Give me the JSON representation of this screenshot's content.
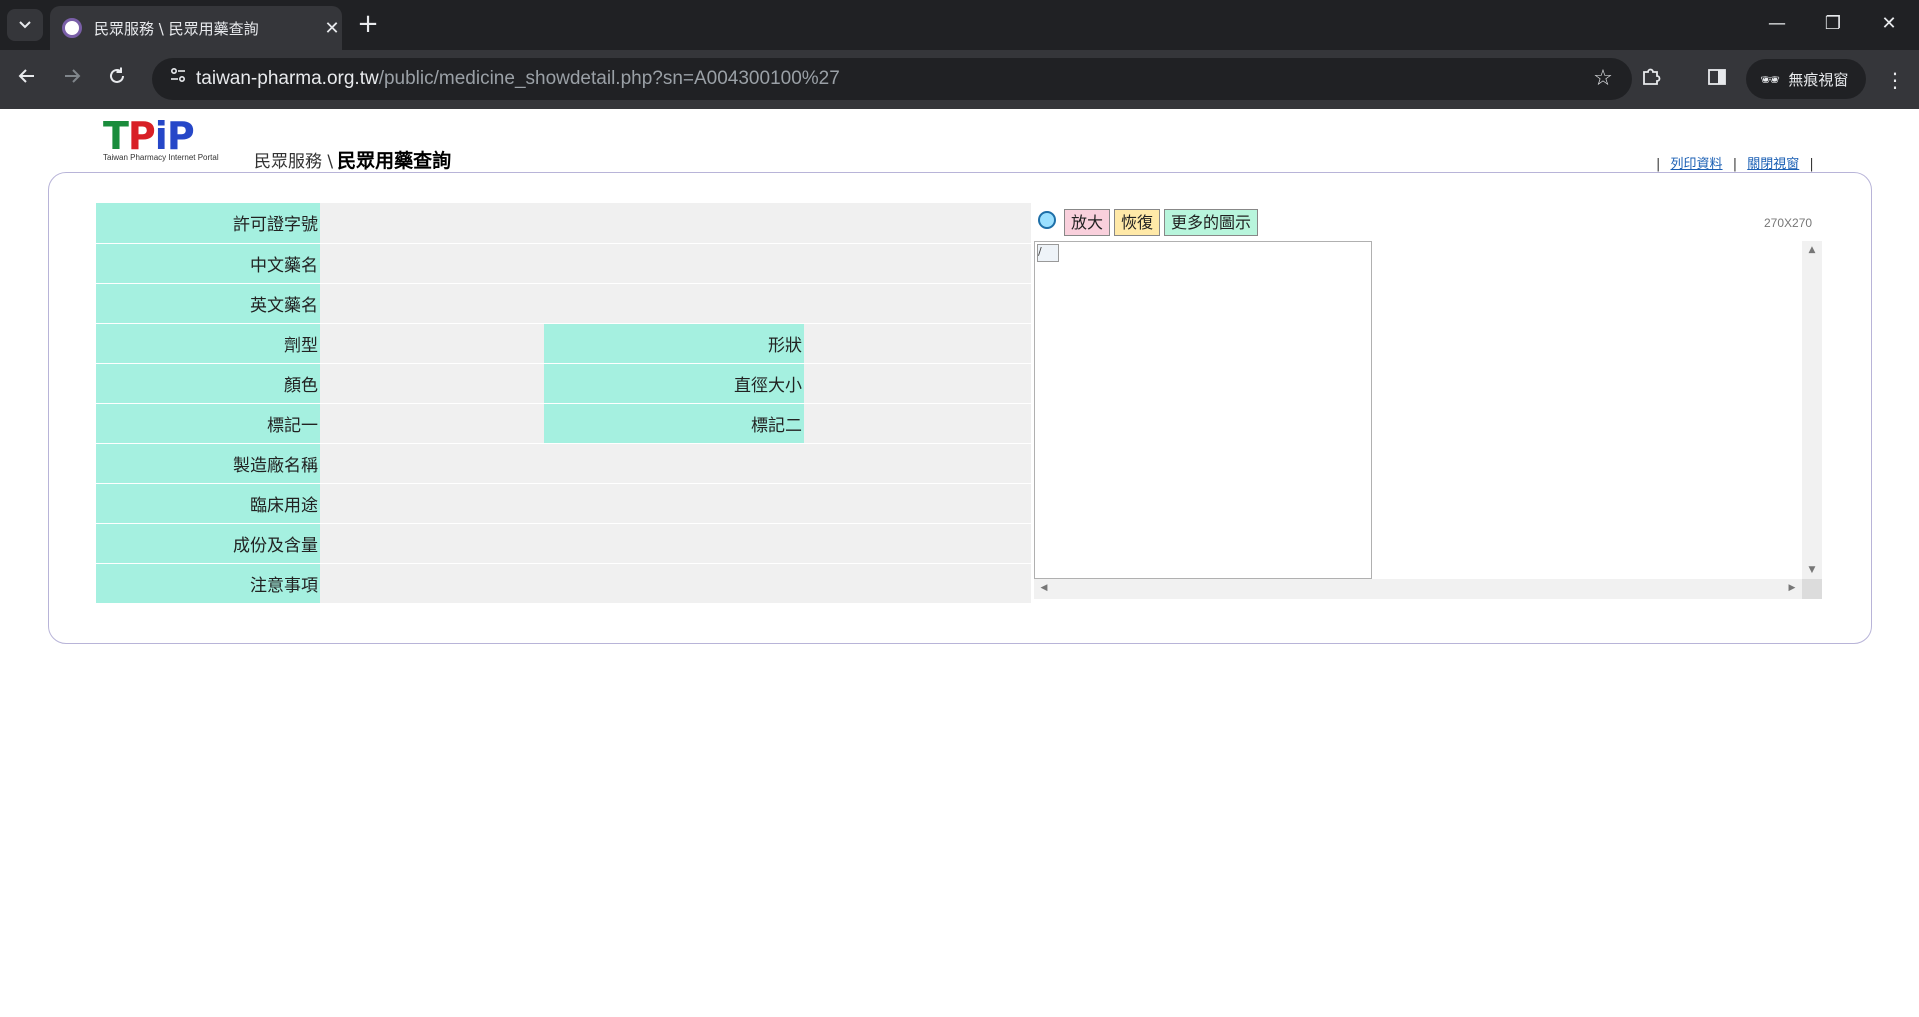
{
  "browser": {
    "tab_title": "民眾服務 \\ 民眾用藥查詢",
    "url_host": "taiwan-pharma.org.tw",
    "url_path": "/public/medicine_showdetail.php?sn=A004300100%27",
    "incognito_label": "無痕視窗",
    "icons": {
      "tab_search": "chevron-down-icon",
      "tab_close": "close-icon",
      "new_tab": "plus-icon",
      "back": "arrow-left-icon",
      "forward": "arrow-right-icon",
      "reload": "reload-icon",
      "site_info": "site-info-icon",
      "bookmark": "star-icon",
      "extensions": "puzzle-icon",
      "side_panel": "side-panel-icon",
      "incognito": "incognito-icon",
      "menu": "more-vert-icon",
      "minimize": "minimize-icon",
      "restore": "restore-icon",
      "close_window": "close-icon"
    }
  },
  "logo": {
    "letters": [
      "T",
      "P",
      "i",
      "P"
    ],
    "subtitle": "Taiwan Pharmacy Internet Portal"
  },
  "breadcrumb": {
    "parent": "民眾服務 \\",
    "current": "民眾用藥查詢"
  },
  "toplinks": {
    "sep": "|",
    "print": "列印資料",
    "close": "關閉視窗"
  },
  "info_table": {
    "license_no": {
      "label": "許可證字號",
      "value": ""
    },
    "chinese_name": {
      "label": "中文藥名",
      "value": ""
    },
    "english_name": {
      "label": "英文藥名",
      "value": ""
    },
    "dosage_form": {
      "label": "劑型",
      "value": ""
    },
    "shape": {
      "label": "形狀",
      "value": ""
    },
    "color": {
      "label": "顏色",
      "value": ""
    },
    "diameter": {
      "label": "直徑大小",
      "value": ""
    },
    "mark1": {
      "label": "標記一",
      "value": ""
    },
    "mark2": {
      "label": "標記二",
      "value": ""
    },
    "manufacturer": {
      "label": "製造廠名稱",
      "value": ""
    },
    "clinical_use": {
      "label": "臨床用途",
      "value": ""
    },
    "ingredients": {
      "label": "成份及含量",
      "value": ""
    },
    "precautions": {
      "label": "注意事項",
      "value": ""
    }
  },
  "image_tools": {
    "zoom": "放大",
    "reset": "恢復",
    "more": "更多的圖示",
    "size_label": "270X270",
    "broken_alt": "/"
  },
  "colors": {
    "label_bg": "#a5f0e0",
    "value_bg": "#f0f0f0",
    "panel_border": "#b8b4d8"
  }
}
